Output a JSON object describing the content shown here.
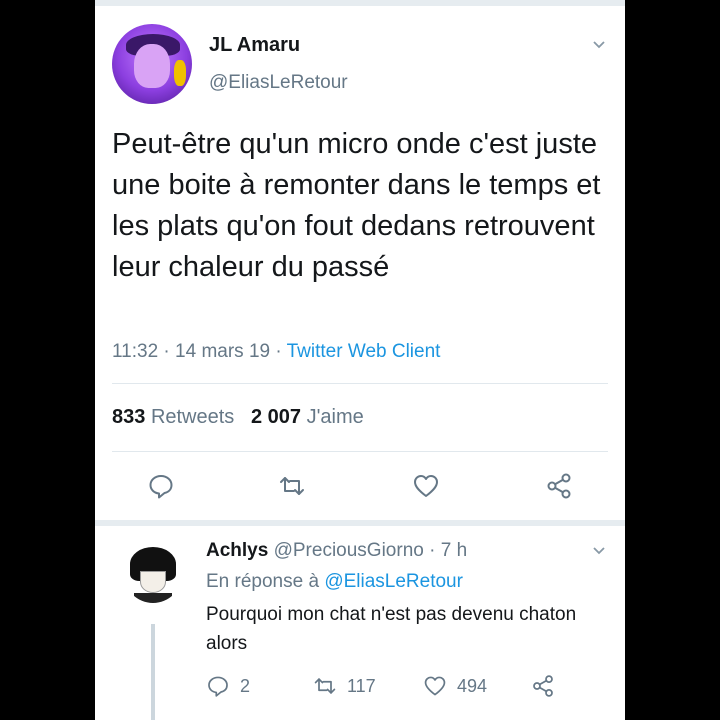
{
  "main_tweet": {
    "name": "JL Amaru",
    "handle": "@EliasLeRetour",
    "text": "Peut-être qu'un micro onde c'est juste une boite à remonter dans le temps et les plats qu'on fout dedans retrouvent leur chaleur du passé",
    "time": "11:32",
    "dot1": " · ",
    "date": "14 mars 19",
    "dot2": " · ",
    "client": "Twitter Web Client",
    "retweets_count": "833",
    "retweets_label": "Retweets",
    "likes_count": "2 007",
    "likes_label": "J'aime"
  },
  "reply_tweet": {
    "name": "Achlys",
    "handle": "@PreciousGiorno",
    "time": " · 7 h",
    "replying_prefix": "En réponse à",
    "replying_to": "@EliasLeRetour",
    "text": "Pourquoi mon chat n'est pas devenu chaton alors",
    "reply_count": "2",
    "retweet_count": "117",
    "like_count": "494"
  },
  "icons": {
    "caret": "chevron-down-icon",
    "reply": "reply-bubble-icon",
    "retweet": "retweet-icon",
    "like": "heart-icon",
    "share": "share-icon"
  },
  "colors": {
    "accent": "#1b95e0",
    "muted_text": "#657786",
    "primary_text": "#14171a",
    "divider": "#e1e8ed"
  }
}
